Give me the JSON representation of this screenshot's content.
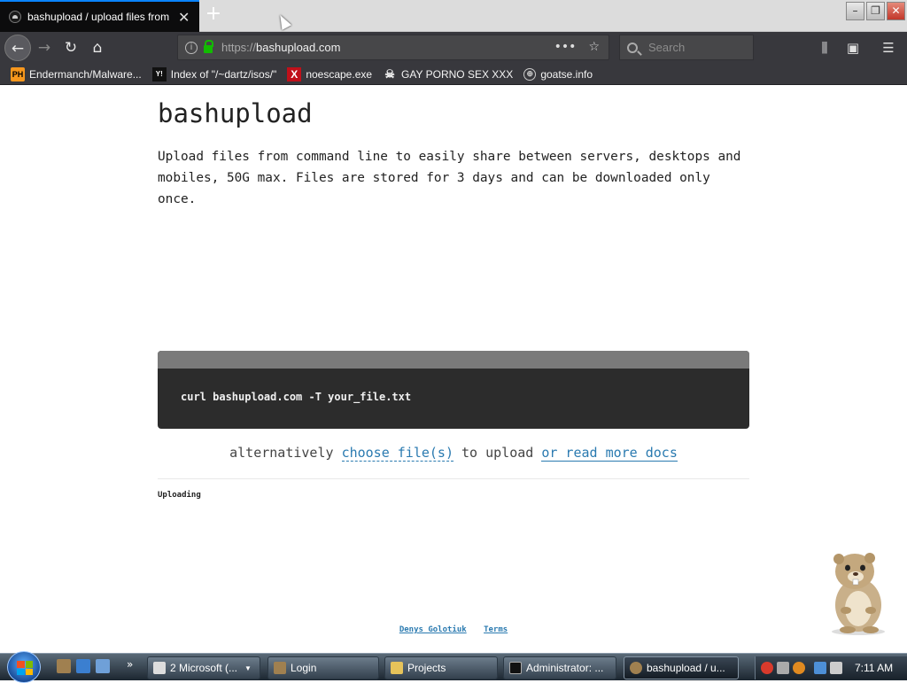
{
  "browser": {
    "tab_title": "bashupload / upload files from",
    "new_tab_symbol": "+",
    "url_scheme": "https://",
    "url_host": "bashupload.com",
    "page_actions_icon": "•••",
    "search_placeholder": "Search",
    "accent_color": "#0a84ff"
  },
  "bookmarks": [
    {
      "label": "Endermanch/Malware...",
      "icon_text": "PH",
      "icon": "pornhub-favicon"
    },
    {
      "label": "Index of \"/~dartz/isos/\"",
      "icon_text": "Y!",
      "icon": "ycombinator-favicon"
    },
    {
      "label": "noescape.exe",
      "icon_text": "X",
      "icon": "x-favicon"
    },
    {
      "label": "GAY PORNO SEX XXX",
      "icon_text": "☠",
      "icon": "skull-favicon"
    },
    {
      "label": "goatse.info",
      "icon_text": "⊕",
      "icon": "globe-favicon"
    }
  ],
  "page": {
    "title": "bashupload",
    "intro": "Upload files from command line to easily share between servers, desktops and mobiles, 50G max. Files are stored for 3 days and can be downloaded only once.",
    "command": "curl bashupload.com -T your_file.txt",
    "alt_prefix": "alternatively ",
    "choose_link": "choose file(s)",
    "alt_middle": " to upload ",
    "docs_link": "or read more docs",
    "status": "Uploading",
    "footer_author": "Denys Golotiuk",
    "footer_terms": "Terms",
    "link_color": "#2a7ab0"
  },
  "taskbar": {
    "buttons": [
      {
        "label": "2 Microsoft (...",
        "icon": "window-icon"
      },
      {
        "label": "Login",
        "icon": "hamster-icon"
      },
      {
        "label": "Projects",
        "icon": "folder-icon"
      },
      {
        "label": "Administrator: ...",
        "icon": "cmd-icon"
      },
      {
        "label": "bashupload / u...",
        "icon": "firefox-icon"
      }
    ],
    "clock": "7:11 AM",
    "quick_launch_more": "»"
  }
}
